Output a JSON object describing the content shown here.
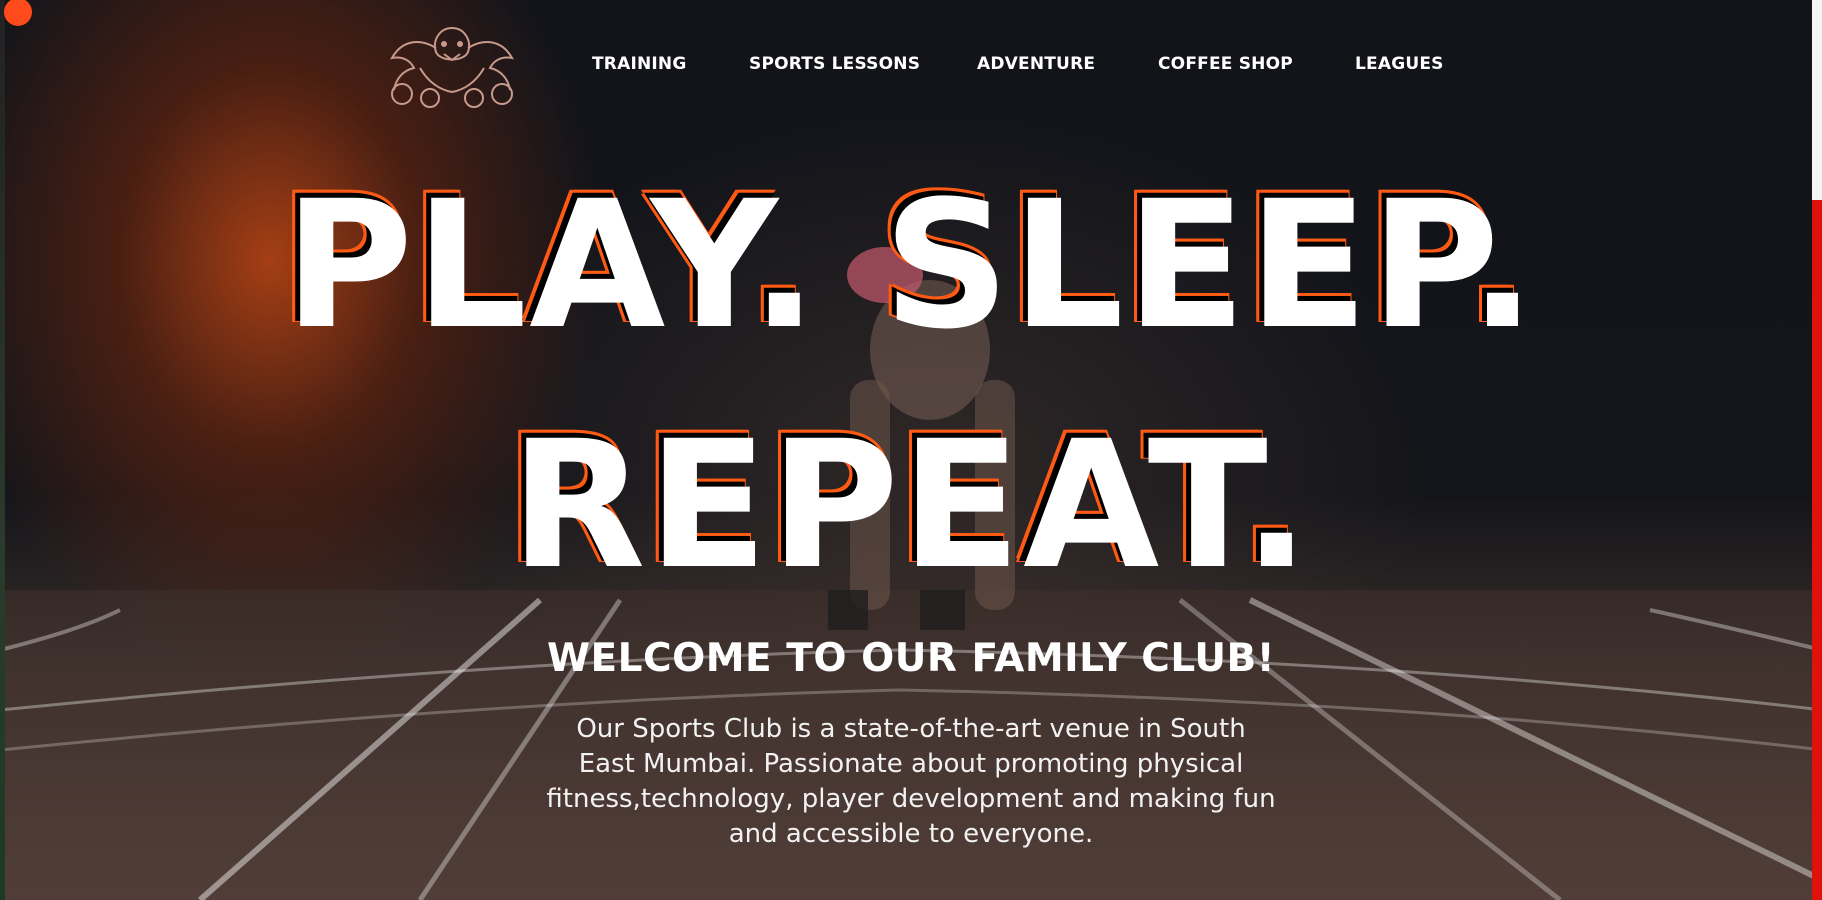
{
  "brand": {
    "logo_icon": "winged-crest-logo"
  },
  "nav": {
    "items": [
      {
        "label": "TRAINING"
      },
      {
        "label": "SPORTS LESSONS"
      },
      {
        "label": "ADVENTURE"
      },
      {
        "label": "COFFEE SHOP"
      },
      {
        "label": "LEAGUES"
      }
    ]
  },
  "hero": {
    "line1": "PLAY. SLEEP.",
    "line2": "REPEAT.",
    "welcome": "WELCOME TO OUR FAMILY CLUB!",
    "intro": "Our Sports Club is a state-of-the-art venue in South East Mumbai. Passionate about promoting physical fitness,technology, player development and making fun and accessible to everyone."
  },
  "colors": {
    "accent": "#ff5a14",
    "text": "#ffffff",
    "scroll_indicator": "#e0100a"
  }
}
